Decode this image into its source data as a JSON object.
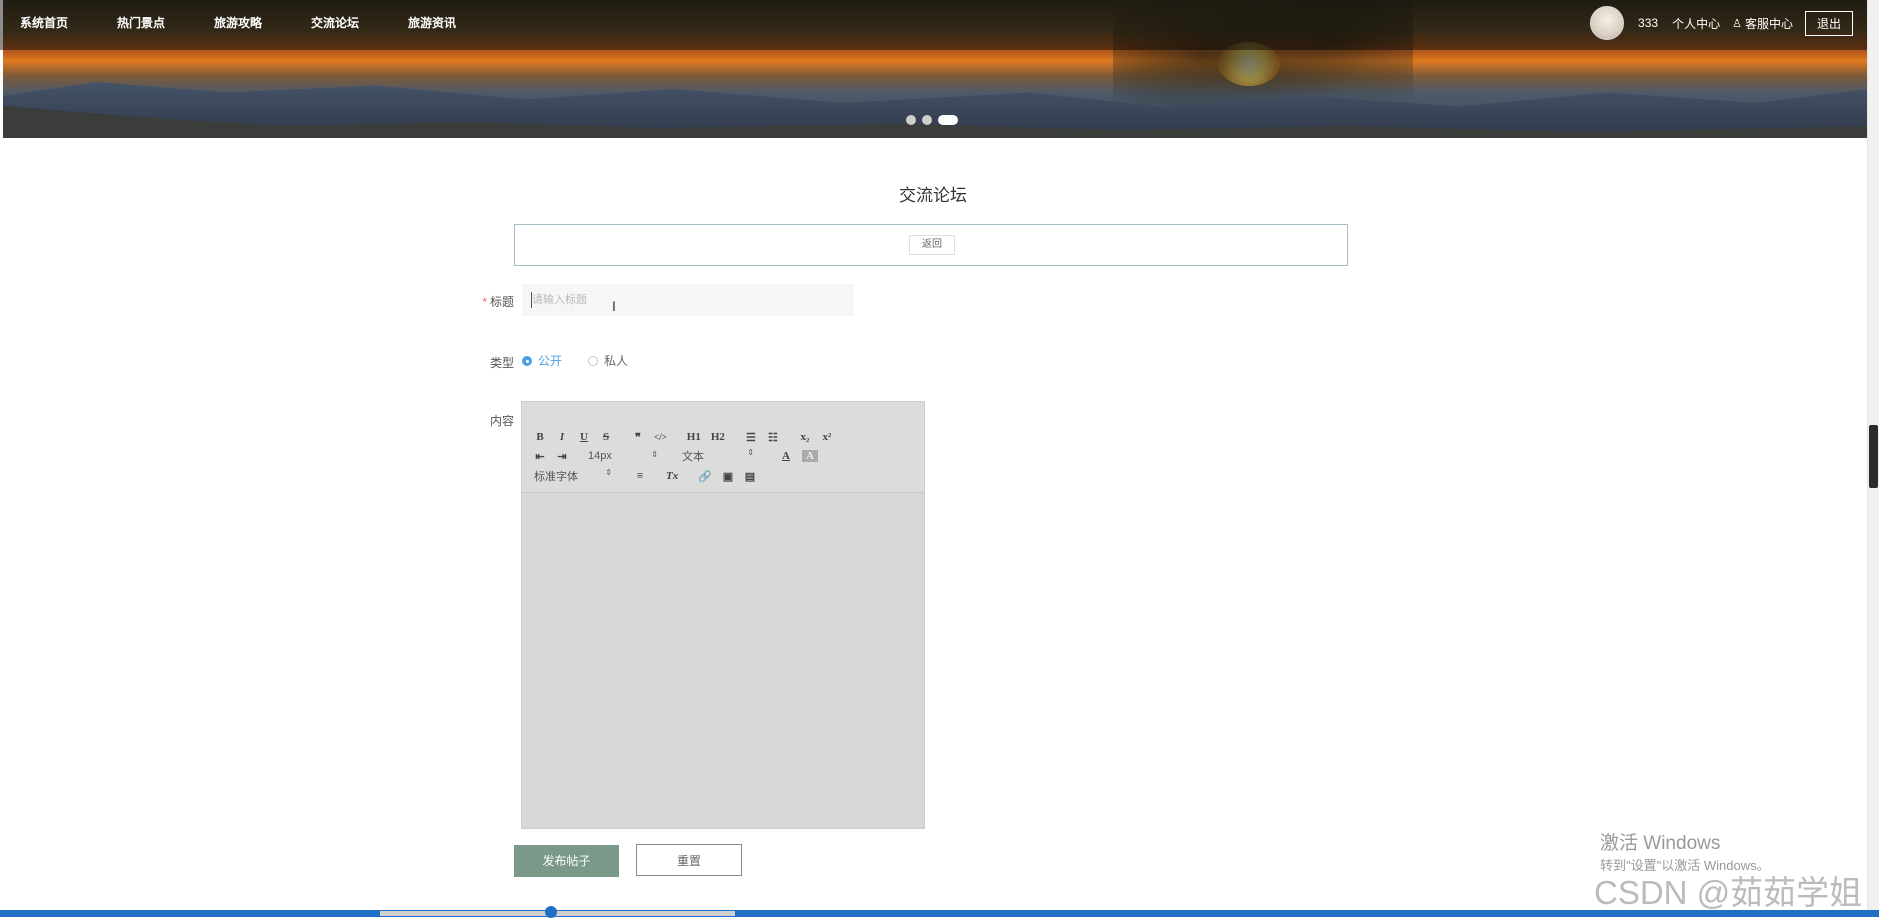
{
  "nav": {
    "items": [
      "系统首页",
      "热门景点",
      "旅游攻略",
      "交流论坛",
      "旅游资讯"
    ]
  },
  "user": {
    "name": "333",
    "personal_center": "个人中心",
    "service_center": "客服中心",
    "logout": "退出"
  },
  "carousel": {
    "slides": 3,
    "active_index": 2
  },
  "page": {
    "title": "交流论坛"
  },
  "actions": {
    "back": "返回"
  },
  "form": {
    "title_label": "标题",
    "title_placeholder": "请输入标题",
    "type_label": "类型",
    "type_options": [
      "公开",
      "私人"
    ],
    "type_selected": "公开",
    "content_label": "内容"
  },
  "editor": {
    "row1": [
      "B",
      "I",
      "U",
      "S",
      "❞",
      "</>",
      "H1",
      "H2",
      "☰",
      "☷",
      "x₂",
      "x²"
    ],
    "row2_font_size": "14px",
    "row2_header": "文本",
    "row3_font": "标准字体"
  },
  "buttons": {
    "submit": "发布帖子",
    "reset": "重置"
  },
  "watermark": {
    "line1": "激活 Windows",
    "line2": "转到\"设置\"以激活 Windows。",
    "line3": "CSDN @茹茹学姐"
  }
}
